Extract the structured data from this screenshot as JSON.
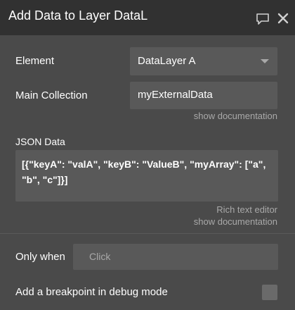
{
  "header": {
    "title": "Add Data to Layer DataL",
    "comment_icon": "speech-bubble-icon",
    "close_icon": "close-icon"
  },
  "element": {
    "label": "Element",
    "selected": "DataLayer A"
  },
  "main_collection": {
    "label": "Main Collection",
    "value": "myExternalData",
    "doc_link": "show documentation"
  },
  "json_data": {
    "label": "JSON Data",
    "value": "[{\"keyA\": \"valA\", \"keyB\": \"ValueB\", \"myArray\": [\"a\", \"b\", \"c\"]}]",
    "rich_text_link": "Rich text editor",
    "doc_link": "show documentation"
  },
  "only_when": {
    "label": "Only when",
    "placeholder": "Click"
  },
  "breakpoint": {
    "label": "Add a breakpoint in debug mode",
    "checked": false
  },
  "colors": {
    "panel_bg": "#4a4a4a",
    "header_bg": "#313131",
    "field_bg": "#595959",
    "muted_text": "#a9a9a9"
  }
}
